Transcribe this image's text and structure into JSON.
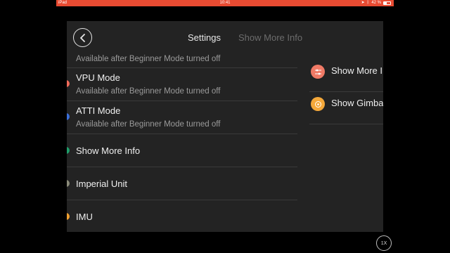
{
  "status_bar": {
    "device": "iPad",
    "time": "10:41",
    "battery": "42 %"
  },
  "header": {
    "tabs": [
      {
        "label": "Settings"
      },
      {
        "label": "Show More Info"
      }
    ]
  },
  "settings_list": [
    {
      "title": "",
      "subtitle": "Available after Beginner Mode turned off",
      "dot_color": "#e84b32"
    },
    {
      "title": "VPU Mode",
      "subtitle": "Available after Beginner Mode turned off",
      "dot_color": "#f06b5a"
    },
    {
      "title": "ATTI Mode",
      "subtitle": "Available after Beginner Mode turned off",
      "dot_color": "#3b6fd9"
    },
    {
      "title": "Show More Info",
      "subtitle": "",
      "dot_color": "#1f9d6a"
    },
    {
      "title": "Imperial Unit",
      "subtitle": "",
      "dot_color": "#8b8b7a"
    },
    {
      "title": "IMU",
      "subtitle": "",
      "dot_color": "#f0a030"
    }
  ],
  "side_list": [
    {
      "label": "Show More I",
      "icon": "sliders-icon",
      "icon_color": "#f07a66"
    },
    {
      "label": "Show Gimba",
      "icon": "gimbal-icon",
      "icon_color": "#f4a83a"
    }
  ],
  "zoom_badge": "1X",
  "colors": {
    "accent": "#e84b32",
    "panel_bg": "#232323"
  }
}
